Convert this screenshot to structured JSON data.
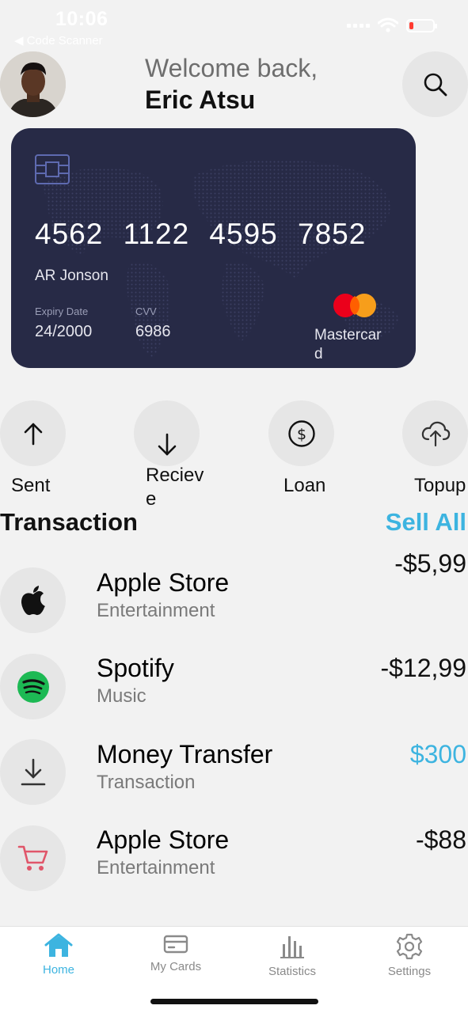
{
  "status_bar": {
    "time": "10:06",
    "back_label": "◀ Code Scanner"
  },
  "header": {
    "welcome": "Welcome back,",
    "username": "Eric Atsu"
  },
  "card": {
    "number": "4562 1122 4595 7852",
    "holder": "AR Jonson",
    "expiry_label": "Expiry Date",
    "expiry_value": "24/2000",
    "cvv_label": "CVV",
    "cvv_value": "6986",
    "brand": "Mastercard",
    "background_color": "#272a46"
  },
  "actions": [
    {
      "label": "Sent",
      "icon": "arrow-up-icon"
    },
    {
      "label": "Recieve",
      "icon": "arrow-down-icon"
    },
    {
      "label": "Loan",
      "icon": "dollar-circle-icon"
    },
    {
      "label": "Topup",
      "icon": "cloud-upload-icon"
    }
  ],
  "transactions_section": {
    "title": "Transaction",
    "see_all": "Sell All"
  },
  "transactions": [
    {
      "name": "Apple Store",
      "category": "Entertainment",
      "amount": "-$5,99",
      "icon": "apple-icon"
    },
    {
      "name": "Spotify",
      "category": "Music",
      "amount": "-$12,99",
      "icon": "spotify-icon"
    },
    {
      "name": "Money Transfer",
      "category": "Transaction",
      "amount": "$300",
      "icon": "download-icon"
    },
    {
      "name": "Apple Store",
      "category": "Entertainment",
      "amount": "-$88",
      "icon": "cart-icon"
    }
  ],
  "tabs": [
    {
      "label": "Home",
      "icon": "home-icon",
      "active": true
    },
    {
      "label": "My Cards",
      "icon": "card-icon",
      "active": false
    },
    {
      "label": "Statistics",
      "icon": "bar-chart-icon",
      "active": false
    },
    {
      "label": "Settings",
      "icon": "gear-icon",
      "active": false
    }
  ],
  "colors": {
    "accent": "#3db4e0",
    "background": "#f2f2f2",
    "card": "#272a46",
    "spotify": "#1db954",
    "cart": "#e0566a"
  }
}
